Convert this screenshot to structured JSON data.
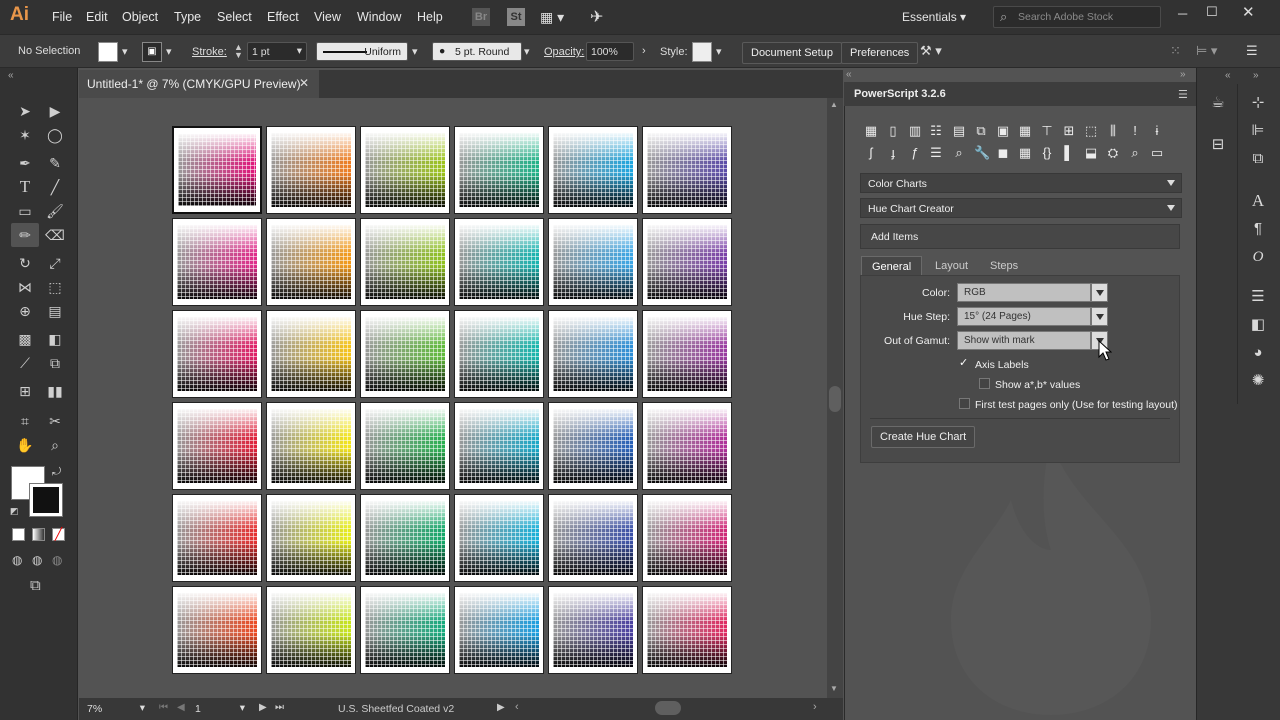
{
  "app": {
    "logo": "Ai",
    "menu": [
      "File",
      "Edit",
      "Object",
      "Type",
      "Select",
      "Effect",
      "View",
      "Window",
      "Help"
    ],
    "bridge_icon": "Br",
    "stock_icon": "St",
    "workspace": "Essentials",
    "search_placeholder": "Search Adobe Stock"
  },
  "control_bar": {
    "selection": "No Selection",
    "stroke_label": "Stroke:",
    "stroke_value": "1 pt",
    "profile": "Uniform",
    "brush": "5 pt. Round",
    "opacity_label": "Opacity:",
    "opacity_value": "100%",
    "style_label": "Style:",
    "document_setup": "Document Setup",
    "preferences": "Preferences"
  },
  "document": {
    "tab_title": "Untitled-1* @ 7% (CMYK/GPU Preview)",
    "zoom": "7%",
    "artboard_number": "1",
    "profile": "U.S. Sheetfed Coated v2"
  },
  "artboard_colors": [
    [
      "#e0147a",
      "#f07d20",
      "#9cc41a",
      "#1fb388",
      "#1ca6e0",
      "#5b4ba8"
    ],
    [
      "#e02a8a",
      "#f59a18",
      "#8fc21e",
      "#18b4b0",
      "#3aa6e6",
      "#7a3fa8"
    ],
    [
      "#e01e66",
      "#f7c419",
      "#5fbb3a",
      "#16b6ac",
      "#2c8fd8",
      "#9a3aa0"
    ],
    [
      "#e0203a",
      "#f5e61a",
      "#28b050",
      "#19a8c8",
      "#2660b8",
      "#b0309a"
    ],
    [
      "#e63030",
      "#e8ee1a",
      "#12a868",
      "#18b0d8",
      "#3a50a8",
      "#d02878"
    ],
    [
      "#ec4a22",
      "#c8e61a",
      "#14aa7c",
      "#1a9ee0",
      "#4a40a0",
      "#e02a62"
    ]
  ],
  "panel": {
    "title": "PowerScript 3.2.6",
    "category": "Color Charts",
    "script": "Hue Chart Creator",
    "add_items": "Add Items",
    "tabs": [
      "General",
      "Layout",
      "Steps"
    ],
    "fields": {
      "color_label": "Color:",
      "color_value": "RGB",
      "hue_step_label": "Hue Step:",
      "hue_step_value": "15° (24 Pages)",
      "gamut_label": "Out of Gamut:",
      "gamut_value": "Show with mark"
    },
    "checkboxes": {
      "axis_labels": "Axis Labels",
      "axis_labels_checked": true,
      "show_ab": "Show a*,b* values",
      "show_ab_checked": false,
      "first_test": "First test pages only (Use for testing layout)",
      "first_test_checked": false
    },
    "create_button": "Create Hue Chart"
  }
}
